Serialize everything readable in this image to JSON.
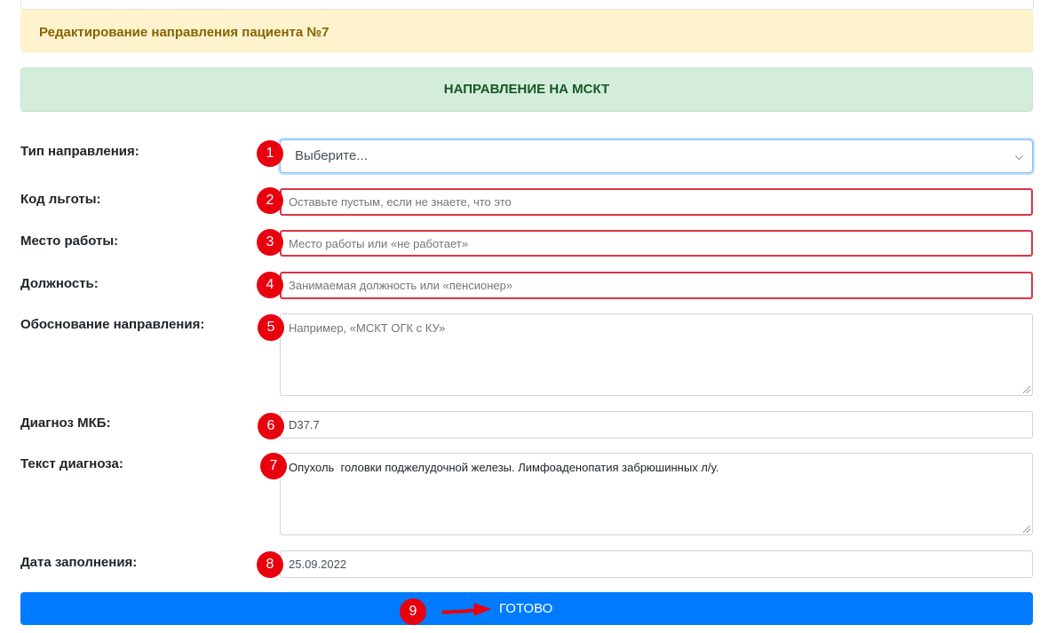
{
  "alert_title": "Редактирование направления пациента №7",
  "section_title": "НАПРАВЛЕНИЕ НА МСКТ",
  "form": {
    "referral_type": {
      "label": "Тип направления:",
      "value": "Выберите...",
      "marker": "1"
    },
    "benefit_code": {
      "label": "Код льготы:",
      "placeholder": "Оставьте пустым, если не знаете, что это",
      "marker": "2"
    },
    "workplace": {
      "label": "Место работы:",
      "placeholder": "Место работы или «не работает»",
      "marker": "3"
    },
    "position": {
      "label": "Должность:",
      "placeholder": "Занимаемая должность или «пенсионер»",
      "marker": "4"
    },
    "justification": {
      "label": "Обоснование направления:",
      "placeholder": "Например, «МСКТ ОГК с КУ»",
      "marker": "5"
    },
    "icd_diagnosis": {
      "label": "Диагноз МКБ:",
      "value": "D37.7",
      "marker": "6"
    },
    "diagnosis_text": {
      "label": "Текст диагноза:",
      "value": "Опухоль  головки поджелудочной железы. Лимфоаденопатия забрюшинных л/у.",
      "marker": "7"
    },
    "fill_date": {
      "label": "Дата заполнения:",
      "value": "25.09.2022",
      "marker": "8"
    }
  },
  "submit": {
    "label": "ГОТОВО",
    "marker": "9"
  },
  "colors": {
    "marker": "#e8000f",
    "invalid_border": "#dc3545",
    "primary_button": "#007bff",
    "warning_bg": "#fff3cd",
    "success_bg": "#d4edda"
  }
}
